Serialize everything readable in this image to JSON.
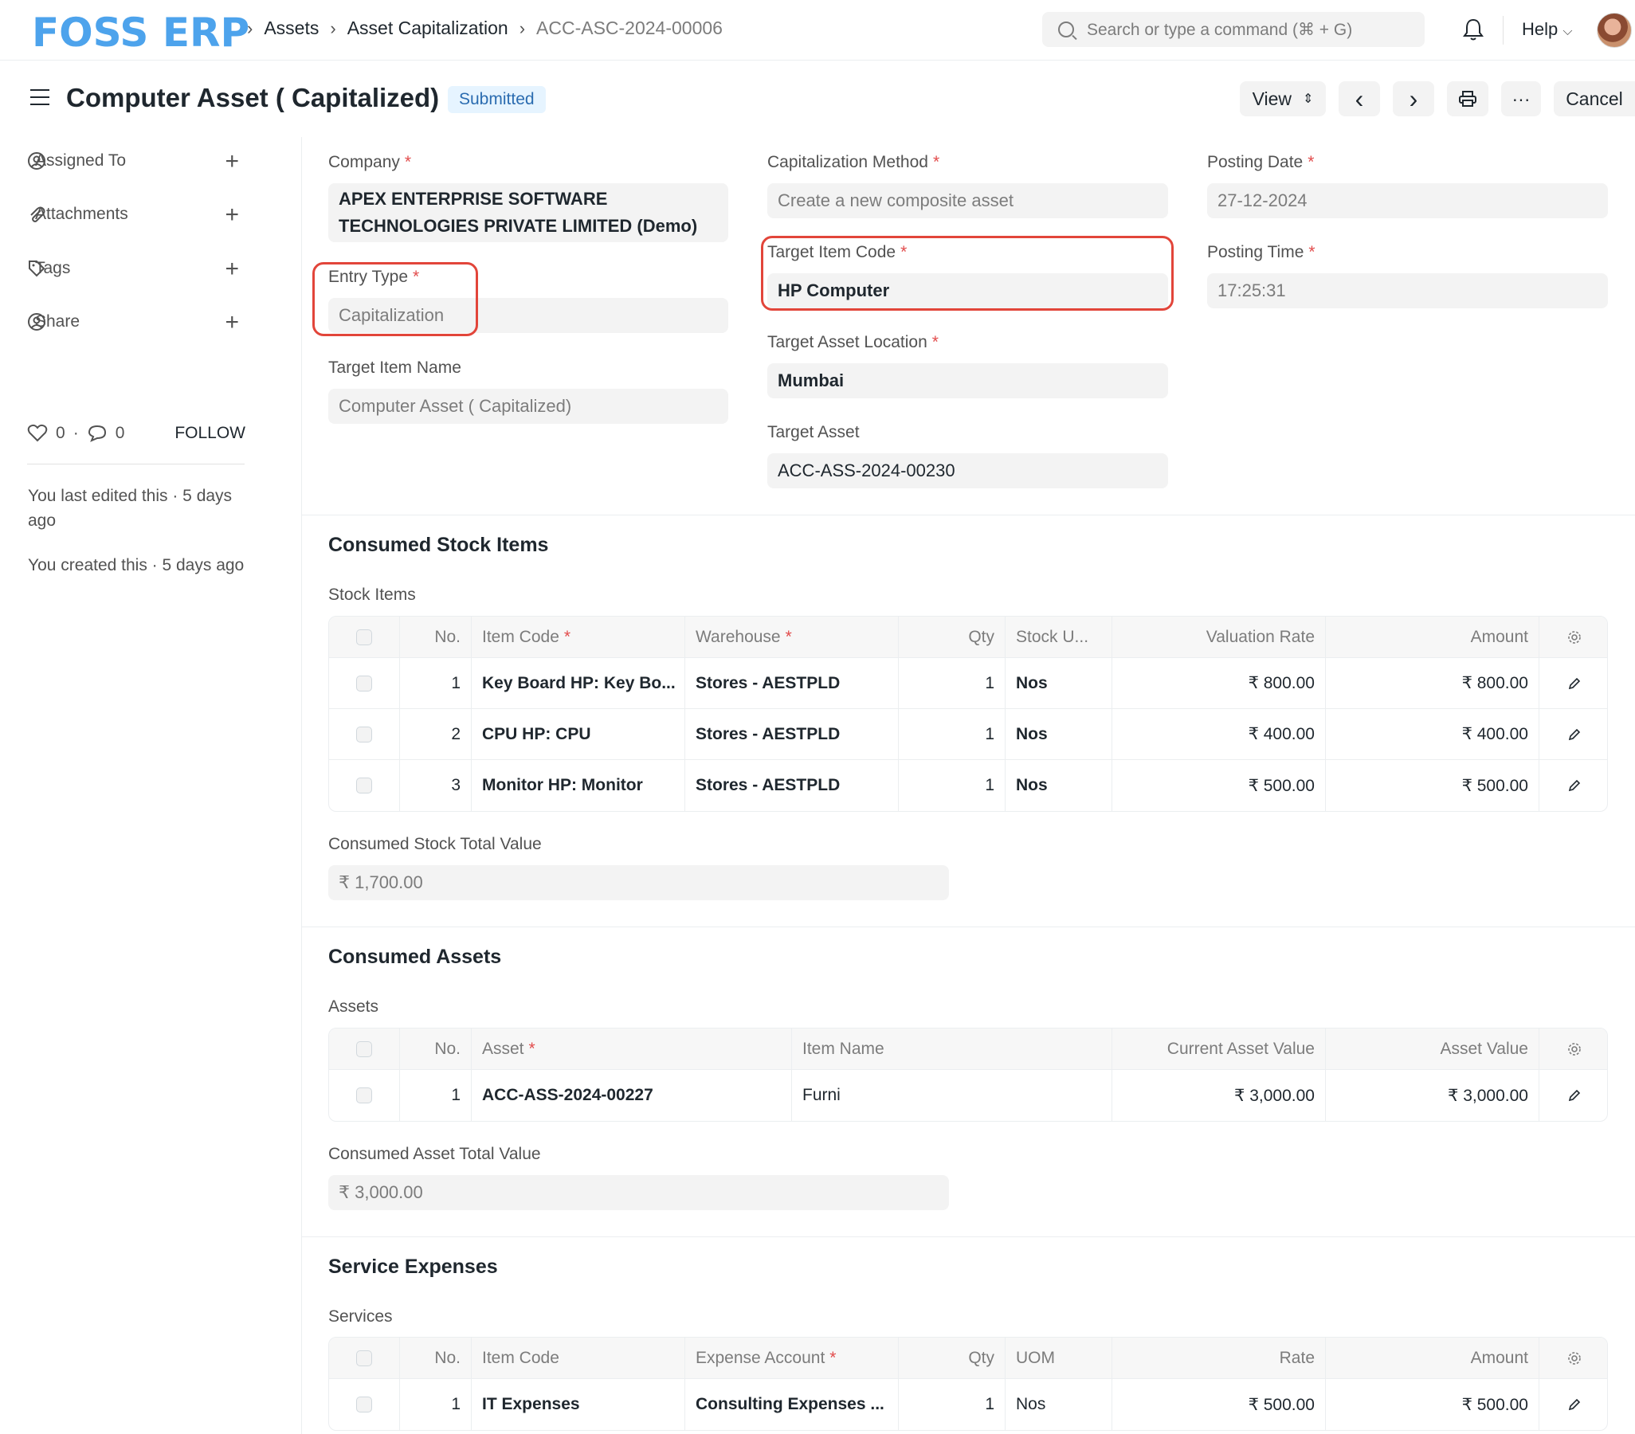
{
  "navbar": {
    "logo": "FOSS ERP",
    "breadcrumbs": [
      "Assets",
      "Asset Capitalization",
      "ACC-ASC-2024-00006"
    ],
    "search_placeholder": "Search or type a command (⌘ + G)",
    "help_label": "Help"
  },
  "page": {
    "title": "Computer Asset ( Capitalized)",
    "status": "Submitted",
    "buttons": {
      "view": "View",
      "prev": "‹",
      "next": "›",
      "more": "···",
      "cancel": "Cancel"
    }
  },
  "sidebar": {
    "items": [
      {
        "label": "Assigned To"
      },
      {
        "label": "Attachments"
      },
      {
        "label": "Tags"
      },
      {
        "label": "Share"
      }
    ],
    "likes": "0",
    "comments": "0",
    "follow": "FOLLOW",
    "edited": "You last edited this · 5 days ago",
    "created": "You created this · 5 days ago"
  },
  "form": {
    "company": {
      "label": "Company",
      "value": "APEX ENTERPRISE SOFTWARE TECHNOLOGIES PRIVATE LIMITED (Demo)"
    },
    "entry_type": {
      "label": "Entry Type",
      "value": "Capitalization"
    },
    "target_item_name": {
      "label": "Target Item Name",
      "value": "Computer Asset ( Capitalized)"
    },
    "capitalization_method": {
      "label": "Capitalization Method",
      "value": "Create a new composite asset"
    },
    "target_item_code": {
      "label": "Target Item Code",
      "value": "HP Computer"
    },
    "target_asset_location": {
      "label": "Target Asset Location",
      "value": "Mumbai"
    },
    "target_asset": {
      "label": "Target Asset",
      "value": "ACC-ASS-2024-00230"
    },
    "posting_date": {
      "label": "Posting Date",
      "value": "27-12-2024"
    },
    "posting_time": {
      "label": "Posting Time",
      "value": "17:25:31"
    }
  },
  "stock": {
    "section_title": "Consumed Stock Items",
    "table_title": "Stock Items",
    "headers": [
      "No.",
      "Item Code",
      "Warehouse",
      "Qty",
      "Stock U...",
      "Valuation Rate",
      "Amount"
    ],
    "rows": [
      [
        "1",
        "Key Board HP: Key Bo...",
        "Stores - AESTPLD",
        "1",
        "Nos",
        "₹ 800.00",
        "₹ 800.00"
      ],
      [
        "2",
        "CPU HP: CPU",
        "Stores - AESTPLD",
        "1",
        "Nos",
        "₹ 400.00",
        "₹ 400.00"
      ],
      [
        "3",
        "Monitor HP: Monitor",
        "Stores - AESTPLD",
        "1",
        "Nos",
        "₹ 500.00",
        "₹ 500.00"
      ]
    ],
    "total_label": "Consumed Stock Total Value",
    "total_value": "₹ 1,700.00"
  },
  "assets": {
    "section_title": "Consumed Assets",
    "table_title": "Assets",
    "headers": [
      "No.",
      "Asset",
      "Item Name",
      "Current Asset Value",
      "Asset Value"
    ],
    "rows": [
      [
        "1",
        "ACC-ASS-2024-00227",
        "Furni",
        "₹ 3,000.00",
        "₹ 3,000.00"
      ]
    ],
    "total_label": "Consumed Asset Total Value",
    "total_value": "₹ 3,000.00"
  },
  "services": {
    "section_title": "Service Expenses",
    "table_title": "Services",
    "headers": [
      "No.",
      "Item Code",
      "Expense Account",
      "Qty",
      "UOM",
      "Rate",
      "Amount"
    ],
    "rows": [
      [
        "1",
        "IT Expenses",
        "Consulting Expenses ...",
        "1",
        "Nos",
        "₹ 500.00",
        "₹ 500.00"
      ]
    ]
  },
  "colors": {
    "brand": "#4da3ec",
    "highlight": "#e2453a",
    "required": "#e24c4c",
    "status_bg": "#e6f4ff"
  }
}
